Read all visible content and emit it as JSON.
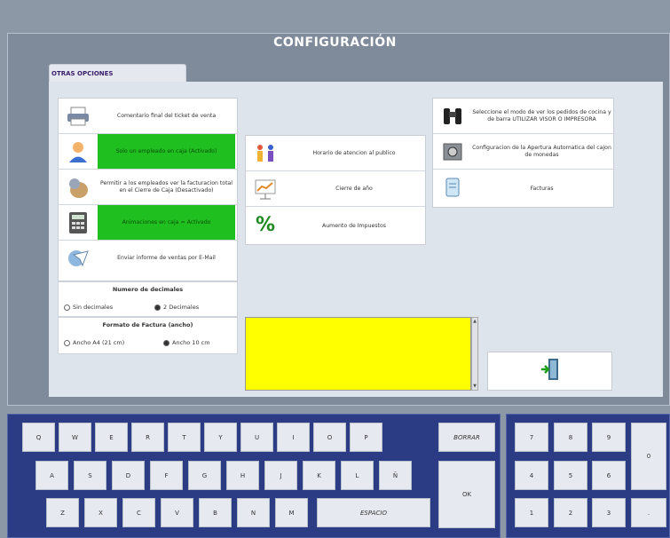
{
  "title": "CONFIGURACIÓN",
  "tab_label": "OTRAS OPCIONES",
  "left_options": [
    {
      "icon": "printer-icon",
      "text": "Comentario final del ticket de venta"
    },
    {
      "icon": "cashier-person-icon",
      "text": "Solo un empleado en caja (Activado)"
    },
    {
      "icon": "money-bag-icon",
      "text": "Permitir a los empleados ver la facturacion total en el Cierre de Caja (Desactivado)"
    },
    {
      "icon": "calculator-icon",
      "text": "Animaciones en caja = Activado"
    },
    {
      "icon": "email-icon",
      "text": "Enviar informe de ventas por E-Mail"
    }
  ],
  "middle_options": [
    {
      "icon": "people-clock-icon",
      "text": "Horario de atencion al publico"
    },
    {
      "icon": "chart-board-icon",
      "text": "Cierre de año"
    },
    {
      "icon": "percent-icon",
      "text": "Aumento de Impuestos"
    }
  ],
  "right_options": [
    {
      "icon": "binoculars-icon",
      "text": "Seleccione el modo de ver los pedidos de cocina y de barra UTILIZAR VISOR O IMPRESORA"
    },
    {
      "icon": "safe-icon",
      "text": "Configuracion de la Apertura Automatica del cajon de monedas"
    },
    {
      "icon": "invoice-icon",
      "text": "Facturas"
    }
  ],
  "decimals": {
    "heading": "Numero de decimales",
    "options": [
      "Sin decimales",
      "2 Decimales"
    ],
    "selected_index": 1
  },
  "invoice_format": {
    "heading": "Formato de Factura (ancho)",
    "options": [
      "Ancho A4 (21 cm)",
      "Ancho 10 cm"
    ],
    "selected_index": 1
  },
  "scroll_up": "▲",
  "scroll_down": "▼",
  "exit_icon": "exit-door-icon",
  "keyboard": {
    "row1": [
      "Q",
      "W",
      "E",
      "R",
      "T",
      "Y",
      "U",
      "I",
      "O",
      "P"
    ],
    "row2": [
      "A",
      "S",
      "D",
      "F",
      "G",
      "H",
      "J",
      "K",
      "L",
      "Ñ"
    ],
    "row3": [
      "Z",
      "X",
      "C",
      "V",
      "B",
      "N",
      "M"
    ],
    "space": "ESPACIO",
    "delete": "BORRAR",
    "ok": "OK"
  },
  "numpad": {
    "keys": [
      "7",
      "8",
      "9",
      "4",
      "5",
      "6",
      "1",
      "2",
      "3",
      "0",
      "."
    ]
  },
  "colors": {
    "active_option": "#1fbf1f",
    "message_area": "#ffff00",
    "keyboard_bg": "#2b3c84"
  }
}
